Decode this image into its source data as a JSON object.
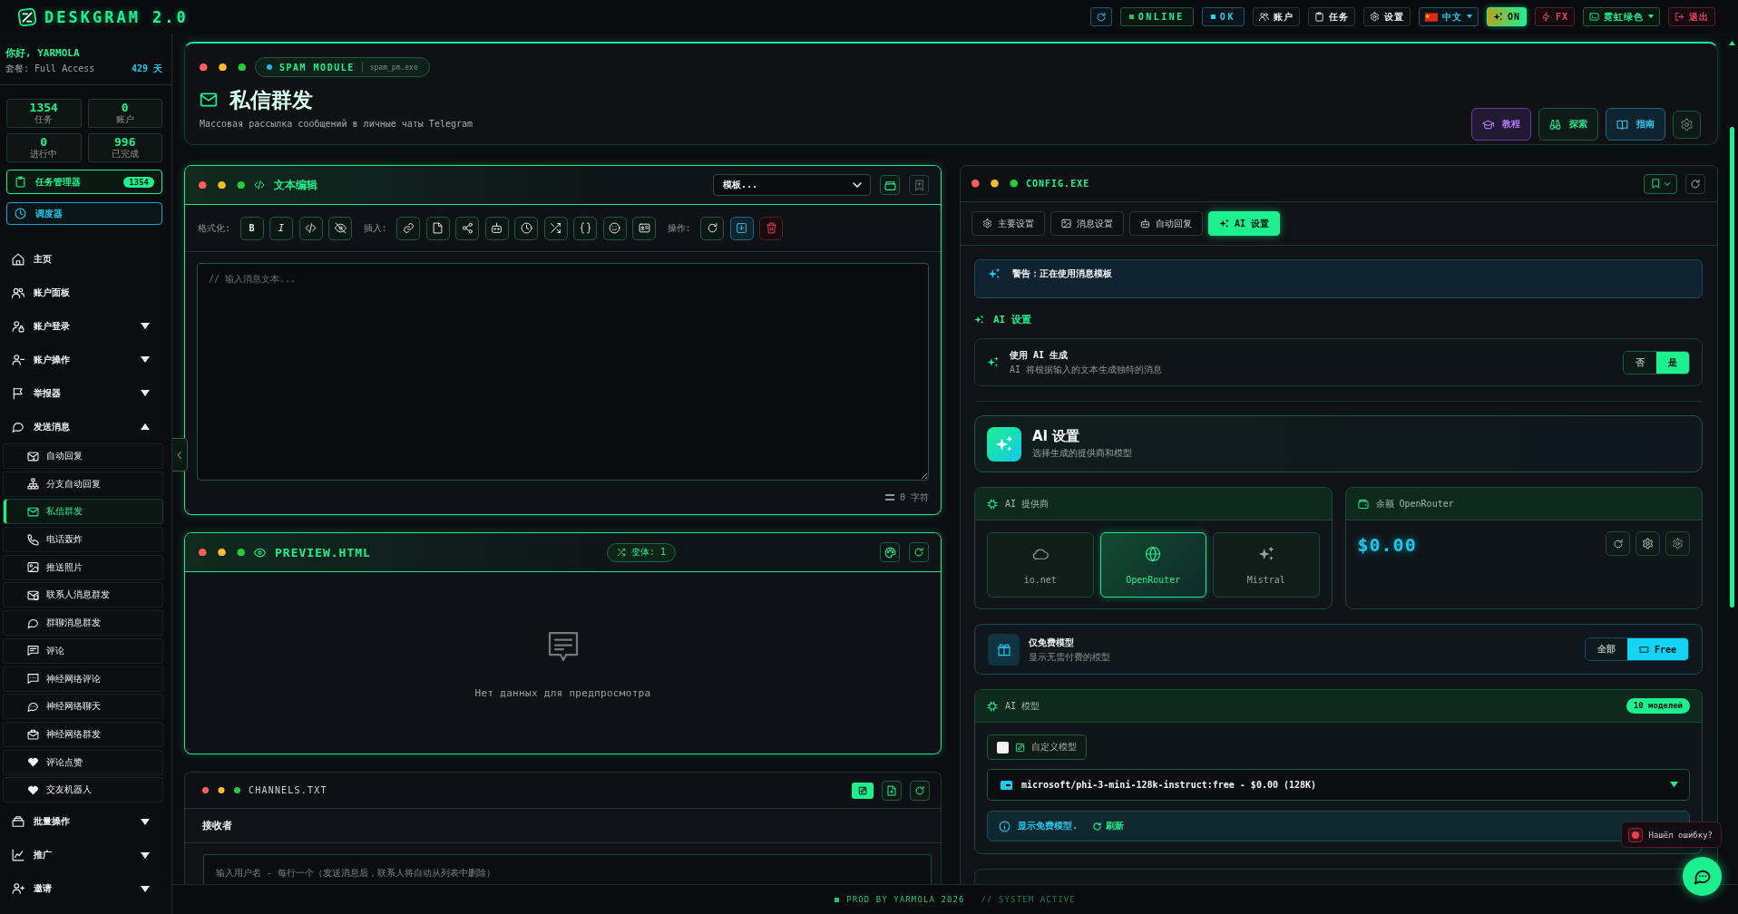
{
  "app": {
    "title": "DESKGRAM 2.0"
  },
  "top_bar": {
    "items": [
      {
        "kind": "status",
        "label": "ONLINE",
        "color": "#22c55e"
      },
      {
        "kind": "status",
        "label": "OK",
        "color": "#22d3ee"
      },
      {
        "kind": "button",
        "label": "账户"
      },
      {
        "kind": "button",
        "label": "任务"
      },
      {
        "kind": "button",
        "label": "设置"
      },
      {
        "kind": "dropdown",
        "label": "中文"
      },
      {
        "kind": "toggle",
        "label": "ON",
        "on": true
      },
      {
        "kind": "button",
        "label": "FX"
      },
      {
        "kind": "dropdown",
        "label": "霓虹绿色"
      },
      {
        "kind": "button",
        "label": "退出"
      }
    ]
  },
  "sidebar": {
    "greeting": "你好, YARMOLA",
    "plan": "套餐: Full Access",
    "days": "429 天",
    "stats": [
      {
        "value": "1354",
        "label": "任务"
      },
      {
        "value": "0",
        "label": "账户"
      },
      {
        "value": "0",
        "label": "进行中"
      },
      {
        "value": "996",
        "label": "已完成"
      }
    ],
    "task_manager": {
      "label": "任务管理器",
      "badge": "1354"
    },
    "scheduler": {
      "label": "调度器"
    },
    "nav": [
      {
        "kind": "link",
        "label": "主页"
      },
      {
        "kind": "link",
        "label": "账户面板"
      },
      {
        "kind": "group",
        "label": "账户登录",
        "expanded": false
      },
      {
        "kind": "group",
        "label": "账户操作",
        "expanded": false
      },
      {
        "kind": "group",
        "label": "举报器",
        "expanded": false
      },
      {
        "kind": "group",
        "label": "发送消息",
        "expanded": true,
        "children": [
          {
            "label": "自动回复",
            "selected": false
          },
          {
            "label": "分支自动回复",
            "selected": false
          },
          {
            "label": "私信群发",
            "selected": true
          },
          {
            "label": "电话轰炸",
            "selected": false
          },
          {
            "label": "推送照片",
            "selected": false
          },
          {
            "label": "联系人消息群发",
            "selected": false
          },
          {
            "label": "群聊消息群发",
            "selected": false
          },
          {
            "label": "评论",
            "selected": false
          },
          {
            "label": "神经网络评论",
            "selected": false
          },
          {
            "label": "神经网络聊天",
            "selected": false
          },
          {
            "label": "神经网络群发",
            "selected": false
          },
          {
            "label": "评论点赞",
            "selected": false
          },
          {
            "label": "交友机器人",
            "selected": false
          }
        ]
      },
      {
        "kind": "group",
        "label": "批量操作",
        "expanded": false
      },
      {
        "kind": "group",
        "label": "推广",
        "expanded": false
      },
      {
        "kind": "group",
        "label": "邀请",
        "expanded": false
      }
    ]
  },
  "module": {
    "tag": "SPAM MODULE",
    "file": "spam_pm.exe",
    "title": "私信群发",
    "subtitle": "Массовая рассылка сообщений в личные чаты Telegram",
    "actions": [
      "教程",
      "探索",
      "指南"
    ]
  },
  "editor": {
    "title": "文本编辑",
    "template_select": {
      "placeholder": "模板..."
    },
    "toolbar": [
      {
        "label": "格式化:",
        "buttons": [
          "B",
          "I"
        ]
      },
      {
        "label": "插入:"
      },
      {
        "label": "操作:"
      }
    ],
    "textarea": {
      "placeholder": "// 输入消息文本..."
    },
    "char_count": "0 字符"
  },
  "preview": {
    "title": "PREVIEW.HTML",
    "variants": "变体: 1",
    "empty_text": "Нет данных для предпросмотра"
  },
  "channels": {
    "title": "CHANNELS.TXT",
    "heading": "接收者",
    "textarea": {
      "placeholder": "输入用户名 - 每行一个（发送消息后，联系人将自动从列表中删除）"
    }
  },
  "config": {
    "title": "CONFIG.EXE",
    "tabs": [
      {
        "label": "主要设置",
        "selected": false
      },
      {
        "label": "消息设置",
        "selected": false
      },
      {
        "label": "自动回复",
        "selected": false
      },
      {
        "label": "AI 设置",
        "selected": true
      }
    ],
    "warning": "警告：正在使用消息模板",
    "section_title": "AI 设置",
    "ai_generation": {
      "title": "使用 AI 生成",
      "description": "AI 将根据输入的文本生成独特的消息",
      "options": [
        {
          "label": "否",
          "selected": false
        },
        {
          "label": "是",
          "selected": true
        }
      ]
    },
    "ai_card": {
      "title": "AI 设置",
      "subtitle": "选择生成的提供商和模型"
    },
    "providers": {
      "title": "AI 提供商",
      "items": [
        {
          "label": "io.net",
          "selected": false
        },
        {
          "label": "OpenRouter",
          "selected": true
        },
        {
          "label": "Mistral",
          "selected": false
        }
      ]
    },
    "balance": {
      "title": "余额 OpenRouter",
      "amount": "$0.00"
    },
    "free_only": {
      "title": "仅免费模型",
      "description": "显示无需付费的模型",
      "options": [
        {
          "label": "全部",
          "selected": false
        },
        {
          "label": "Free",
          "selected": true
        }
      ]
    },
    "models": {
      "title": "AI 模型",
      "count": "10 моделей",
      "custom_model": {
        "label": "自定义模型",
        "checked": false
      },
      "selected_model": "microsoft/phi-3-mini-128k-instruct:free - $0.00 (128K)",
      "info": "显示免费模型.",
      "refresh": "刷新"
    }
  },
  "footer": {
    "brand": "PROD BY YARMOLA 2026",
    "status": "// SYSTEM ACTIVE"
  },
  "bug_report": "Нашёл ошибку?"
}
